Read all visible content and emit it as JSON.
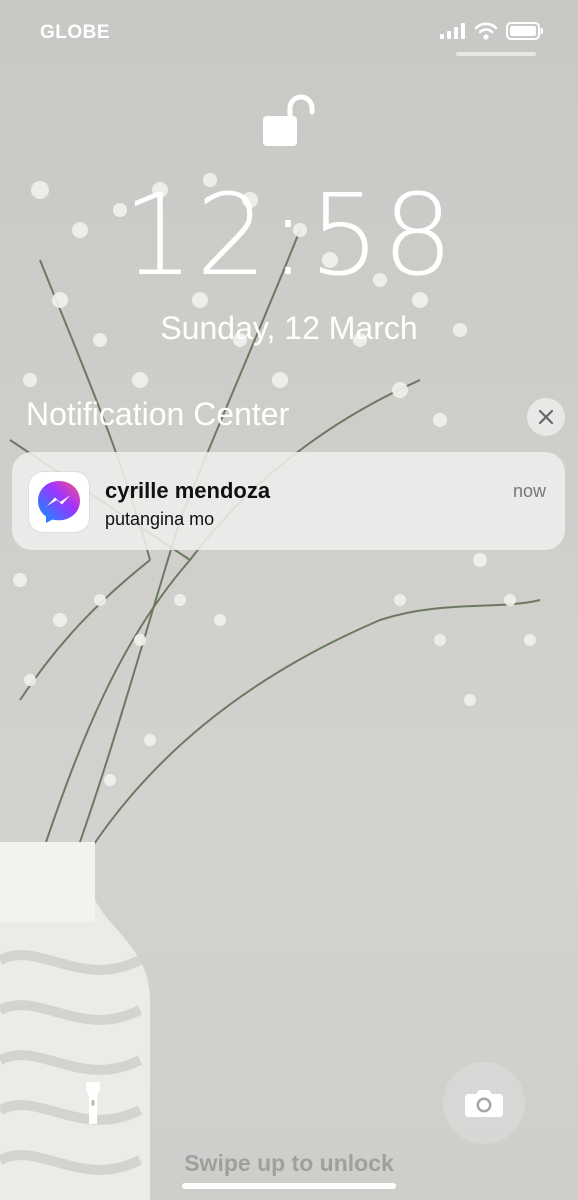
{
  "status_bar": {
    "carrier": "GLOBE",
    "signal_icon": "cellular-signal-icon",
    "wifi_icon": "wifi-icon",
    "battery_icon": "battery-icon"
  },
  "lock": {
    "icon": "unlocked-padlock-icon"
  },
  "clock": {
    "time": "12:58",
    "date": "Sunday, 12 March"
  },
  "notification_center": {
    "title": "Notification Center",
    "close_icon": "close-icon",
    "notification": {
      "app_icon": "messenger-icon",
      "sender": "cyrille mendoza",
      "message": "putangina mo",
      "time": "now"
    }
  },
  "bottom": {
    "flashlight_icon": "flashlight-icon",
    "camera_icon": "camera-icon",
    "swipe_hint": "Swipe up to unlock"
  },
  "colors": {
    "messenger_gradient_start": "#0099ff",
    "messenger_gradient_mid": "#a033ff",
    "messenger_gradient_end": "#ff5280"
  }
}
